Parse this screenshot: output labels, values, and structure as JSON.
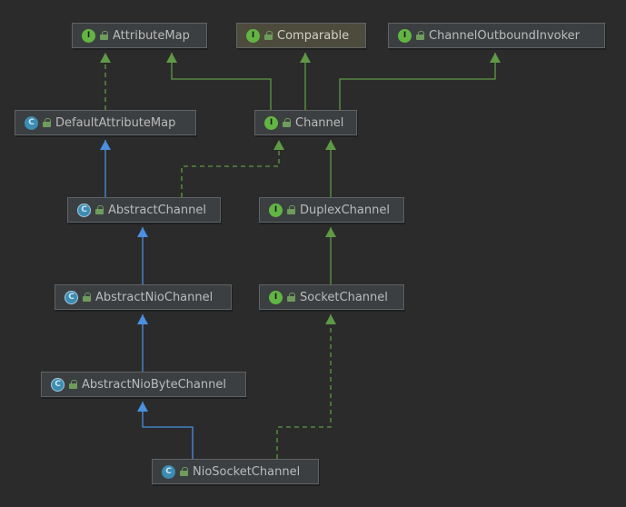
{
  "nodes": {
    "attribute_map": {
      "label": "AttributeMap",
      "kind": "I"
    },
    "comparable": {
      "label": "Comparable",
      "kind": "I"
    },
    "channel_outbound_invoker": {
      "label": "ChannelOutboundInvoker",
      "kind": "I"
    },
    "default_attribute_map": {
      "label": "DefaultAttributeMap",
      "kind": "C"
    },
    "channel": {
      "label": "Channel",
      "kind": "I"
    },
    "abstract_channel": {
      "label": "AbstractChannel",
      "kind": "C"
    },
    "duplex_channel": {
      "label": "DuplexChannel",
      "kind": "I"
    },
    "abstract_nio_channel": {
      "label": "AbstractNioChannel",
      "kind": "C"
    },
    "socket_channel": {
      "label": "SocketChannel",
      "kind": "I"
    },
    "abstract_nio_byte_channel": {
      "label": "AbstractNioByteChannel",
      "kind": "C"
    },
    "nio_socket_channel": {
      "label": "NioSocketChannel",
      "kind": "C"
    }
  },
  "colors": {
    "background": "#2b2b2b",
    "implements_edge": "#5f9a45",
    "extends_edge": "#4a8fe0"
  }
}
